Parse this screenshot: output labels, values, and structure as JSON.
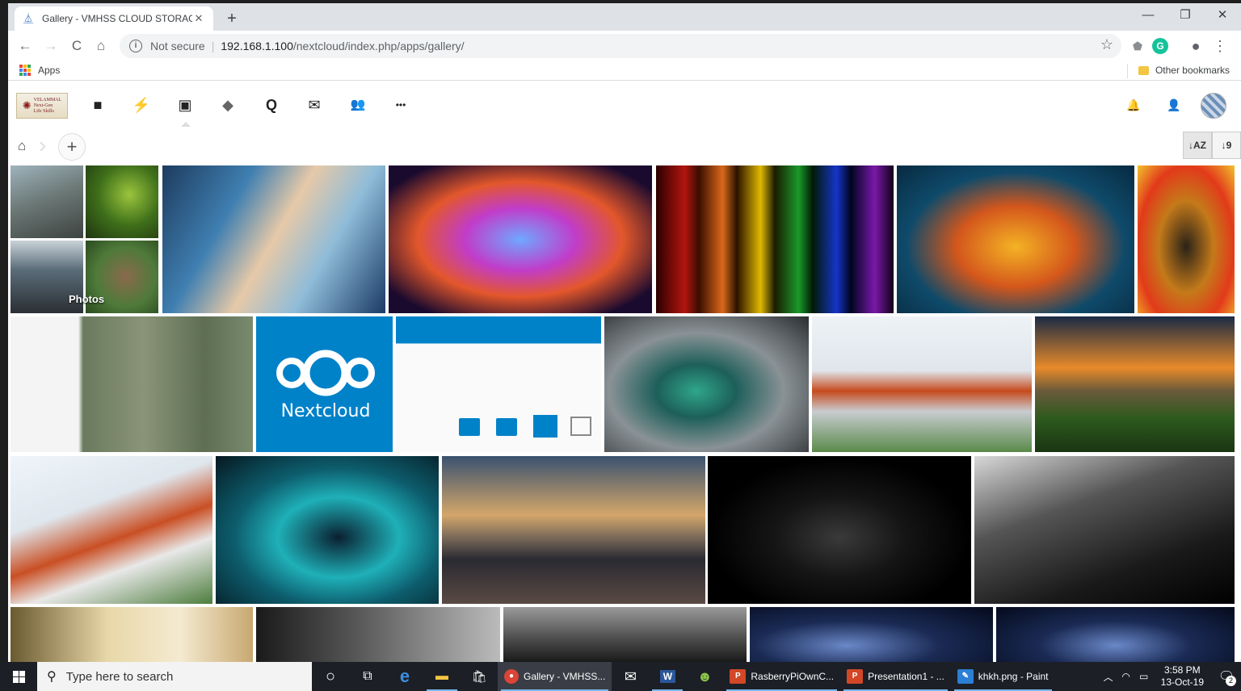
{
  "browser": {
    "tab_title": "Gallery - VMHSS CLOUD STORAGE",
    "tab_close": "✕",
    "new_tab": "+",
    "window_controls": {
      "minimize": "—",
      "maximize": "❐",
      "close": "✕"
    },
    "nav": {
      "back": "←",
      "forward": "→",
      "reload": "C",
      "home": "⌂"
    },
    "address": {
      "info_glyph": "i",
      "security_label": "Not secure",
      "separator": "|",
      "host": "192.168.1.100",
      "path": "/nextcloud/index.php/apps/gallery/",
      "star": "☆"
    },
    "extensions": {
      "shield": "⬟",
      "grammarly": "G",
      "profile": "●",
      "menu": "⋮"
    },
    "bookmarks": {
      "apps_label": "Apps",
      "other_label": "Other bookmarks"
    }
  },
  "nextcloud": {
    "logo_text_1": "VELAMMAL",
    "logo_text_2": "Next-Gen",
    "logo_text_3": "Life Skills",
    "apps": [
      {
        "name": "files",
        "glyph": "■"
      },
      {
        "name": "activity",
        "glyph": "⚡"
      },
      {
        "name": "gallery",
        "glyph": "▣"
      },
      {
        "name": "external",
        "glyph": "◆"
      },
      {
        "name": "talk",
        "glyph": "Q"
      },
      {
        "name": "mail",
        "glyph": "✉"
      },
      {
        "name": "contacts",
        "glyph": "👥"
      },
      {
        "name": "more",
        "glyph": "•••"
      }
    ],
    "right": {
      "bell": "🔔",
      "contacts_menu": "👤"
    },
    "breadcrumb": {
      "home": "⌂",
      "sep": "›",
      "add": "+"
    },
    "sort": {
      "by_name": "↓AZ",
      "by_date": "↓9"
    },
    "album_label": "Photos"
  },
  "taskbar": {
    "search_placeholder": "Type here to search",
    "search_glyph": "⚲",
    "cortana": "○",
    "taskview": "⧉",
    "apps": [
      {
        "label": "Gallery - VMHSS...",
        "badge": "●",
        "color": "#db4437"
      },
      {
        "label": "RasberryPiOwnC...",
        "badge": "P",
        "color": "#d24726"
      },
      {
        "label": "Presentation1 - ...",
        "badge": "P",
        "color": "#d24726"
      },
      {
        "label": "khkh.png - Paint",
        "badge": "✎",
        "color": "#2b7fd4"
      }
    ],
    "pinned": {
      "edge": "e",
      "explorer": "▬",
      "store": "🛍",
      "mail": "✉",
      "word": "W",
      "android": "☻"
    },
    "tray": {
      "chevron": "︿",
      "wifi": "◠",
      "battery": "▭",
      "notification_count": "2"
    },
    "clock": {
      "time": "3:58 PM",
      "date": "13-Oct-19"
    }
  }
}
